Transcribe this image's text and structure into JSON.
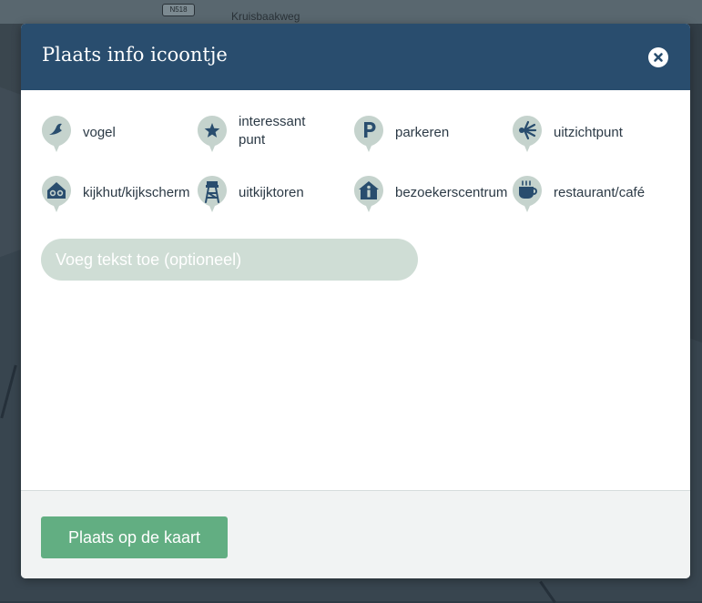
{
  "map": {
    "road_number": "N518",
    "road_name": "Kruisbaakweg"
  },
  "modal": {
    "title": "Plaats info icoontje"
  },
  "icons": [
    {
      "label": "vogel",
      "icon": "bird-icon"
    },
    {
      "label": "interessant punt",
      "icon": "star-icon"
    },
    {
      "label": "parkeren",
      "icon": "parking-icon"
    },
    {
      "label": "uitzichtpunt",
      "icon": "viewpoint-icon"
    },
    {
      "label": "kijkhut/kijkscherm",
      "icon": "binoculars-icon"
    },
    {
      "label": "uitkijktoren",
      "icon": "tower-icon"
    },
    {
      "label": "bezoekerscentrum",
      "icon": "info-house-icon"
    },
    {
      "label": "restaurant/café",
      "icon": "coffee-cup-icon"
    }
  ],
  "text_input": {
    "placeholder": "Voeg tekst toe (optioneel)"
  },
  "footer": {
    "place_button_label": "Plaats op de kaart"
  },
  "colors": {
    "header": "#294d6e",
    "pin": "#c5d3cd",
    "icon": "#294d6e",
    "button": "#62ae82",
    "input": "#cfddd5"
  }
}
